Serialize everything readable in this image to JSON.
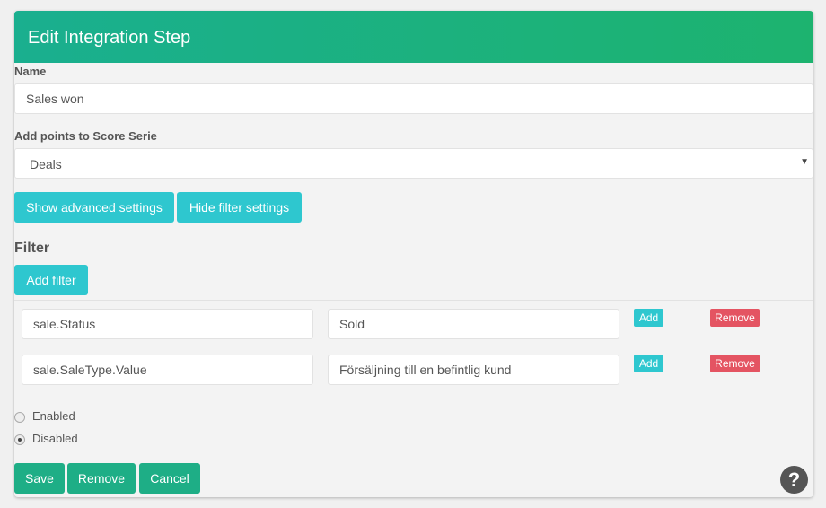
{
  "dialog": {
    "title": "Edit Integration Step"
  },
  "form": {
    "name_label": "Name",
    "name_value": "Sales won",
    "score_label": "Add points to Score Serie",
    "score_value": "Deals"
  },
  "buttons": {
    "show_advanced": "Show advanced settings",
    "hide_filter": "Hide filter settings",
    "add_filter": "Add filter",
    "save": "Save",
    "remove": "Remove",
    "cancel": "Cancel"
  },
  "filter": {
    "heading": "Filter",
    "rows": [
      {
        "field": "sale.Status",
        "value": "Sold",
        "add_label": "Add",
        "remove_label": "Remove"
      },
      {
        "field": "sale.SaleType.Value",
        "value": "Försäljning till en befintlig kund",
        "add_label": "Add",
        "remove_label": "Remove"
      }
    ]
  },
  "status": {
    "options": [
      {
        "label": "Enabled",
        "checked": false
      },
      {
        "label": "Disabled",
        "checked": true
      }
    ]
  },
  "help": {
    "icon": "question-circle-icon",
    "glyph": "?"
  },
  "colors": {
    "header_start": "#1aaf8f",
    "header_end": "#1db36f",
    "cyan_button": "#2ec7cf",
    "green_button": "#1eae86",
    "red_button": "#e45462"
  }
}
